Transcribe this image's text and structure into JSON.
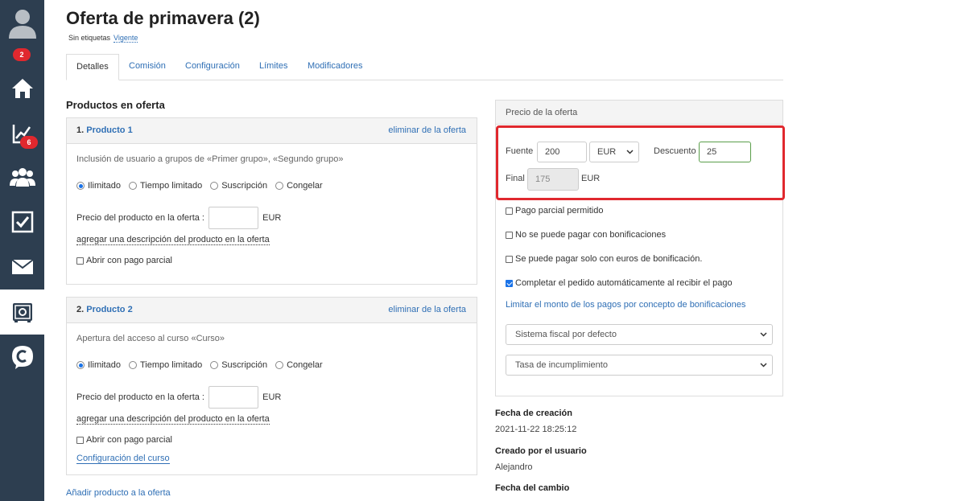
{
  "sidebar": {
    "user_badge": "2",
    "analytics_badge": "6"
  },
  "header": {
    "title": "Oferta de primavera (2)",
    "tags_label": "Sin etiquetas",
    "status": "Vigente"
  },
  "tabs": [
    {
      "label": "Detalles"
    },
    {
      "label": "Comisión"
    },
    {
      "label": "Configuración"
    },
    {
      "label": "Límites"
    },
    {
      "label": "Modificadores"
    }
  ],
  "products": {
    "section_title": "Productos en oferta",
    "remove_label": "eliminar de la oferta",
    "options": [
      "Ilimitado",
      "Tiempo limitado",
      "Suscripción",
      "Congelar"
    ],
    "price_label": "Precio del producto en la oferta :",
    "currency": "EUR",
    "add_description": "agregar una descripción del producto en la oferta",
    "partial_payment": "Abrir con pago parcial",
    "items": [
      {
        "number": "1.",
        "name": "Producto 1",
        "description": "Inclusión de usuario a grupos de «Primer grupo», «Segundo grupo»"
      },
      {
        "number": "2.",
        "name": "Producto 2",
        "description": "Apertura del acceso al curso «Curso»",
        "course_settings": "Configuración del curso"
      }
    ],
    "add_product": "Añadir producto a la oferta"
  },
  "price": {
    "title": "Precio de la oferta",
    "source_label": "Fuente",
    "source_value": "200",
    "currency": "EUR",
    "discount_label": "Descuento",
    "discount_value": "25",
    "final_label": "Final",
    "final_value": "175",
    "final_currency": "EUR",
    "checks": [
      {
        "label": "Pago parcial permitido",
        "checked": false
      },
      {
        "label": "No se puede pagar con bonificaciones",
        "checked": false
      },
      {
        "label": "Se puede pagar solo con euros de bonificación.",
        "checked": false
      },
      {
        "label": "Completar el pedido automáticamente al recibir el pago",
        "checked": true
      }
    ],
    "limit_link": "Limitar el monto de los pagos por concepto de bonificaciones",
    "tax_system": "Sistema fiscal por defecto",
    "default_rate": "Tasa de incumplimiento"
  },
  "meta": {
    "created_label": "Fecha de creación",
    "created_value": "2021-11-22 18:25:12",
    "created_by_label": "Creado por el usuario",
    "created_by_value": "Alejandro",
    "changed_label": "Fecha del cambio"
  },
  "colors": {
    "sidebar": "#2d3e50",
    "link": "#2f6fb5",
    "highlight": "#e0282e"
  }
}
